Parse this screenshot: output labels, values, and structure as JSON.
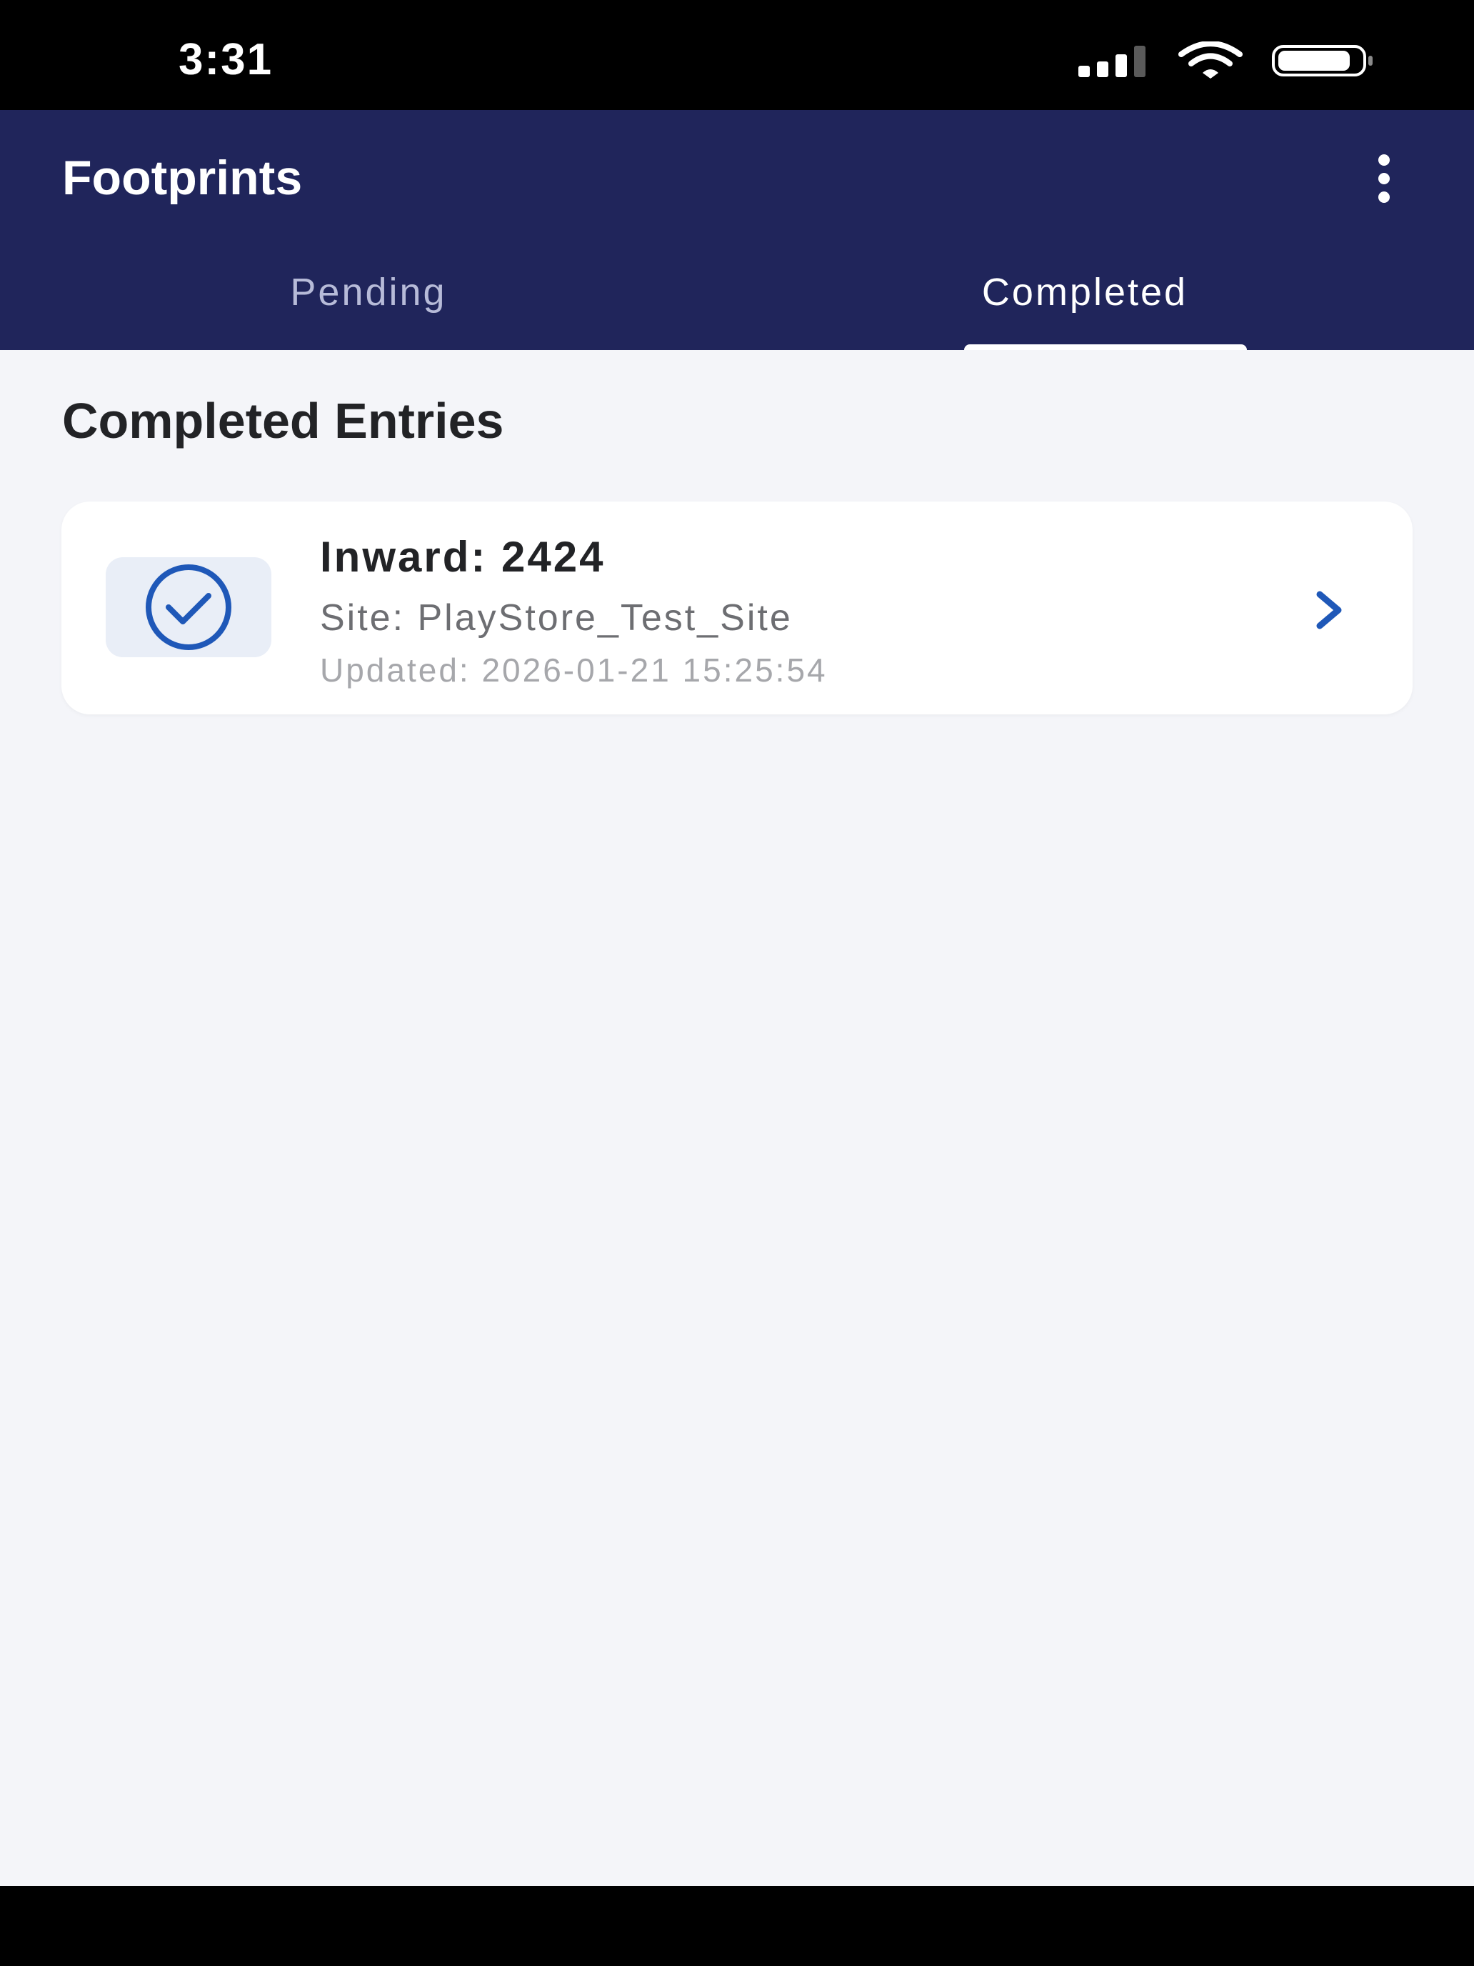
{
  "status_bar": {
    "time": "3:31"
  },
  "header": {
    "title": "Footprints",
    "more_icon": "more-vertical-icon"
  },
  "tabs": [
    {
      "label": "Pending",
      "active": false
    },
    {
      "label": "Completed",
      "active": true
    }
  ],
  "content": {
    "section_title": "Completed Entries",
    "entries": [
      {
        "icon": "check-circle-icon",
        "title": "Inward: 2424",
        "site": "Site: PlayStore_Test_Site",
        "updated": "Updated: 2026-01-21 15:25:54"
      }
    ]
  },
  "colors": {
    "header_bg": "#20255b",
    "content_bg": "#f4f5f9",
    "accent_blue": "#1f58b8",
    "icon_box_bg": "#e9eef7"
  }
}
